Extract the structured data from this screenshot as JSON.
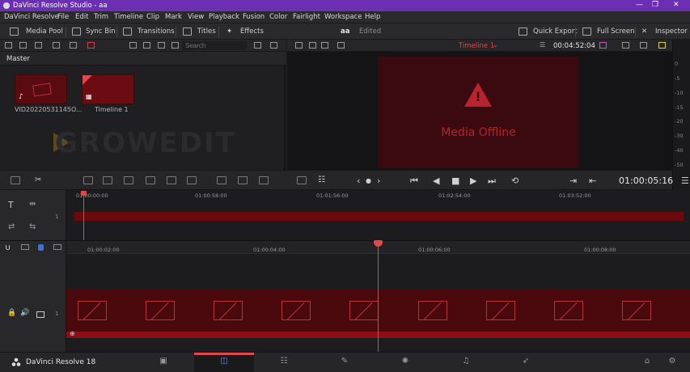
{
  "window": {
    "title": "DaVinci Resolve Studio - aa"
  },
  "menu": [
    "DaVinci Resolve",
    "File",
    "Edit",
    "Trim",
    "Timeline",
    "Clip",
    "Mark",
    "View",
    "Playback",
    "Fusion",
    "Color",
    "Fairlight",
    "Workspace",
    "Help"
  ],
  "toolbar": {
    "media_pool": "Media Pool",
    "sync_bin": "Sync Bin",
    "transitions": "Transitions",
    "titles": "Titles",
    "effects": "Effects",
    "project_name": "aa",
    "project_status": "Edited",
    "quick_export": "Quick Export",
    "full_screen": "Full Screen",
    "inspector": "Inspector"
  },
  "search": {
    "placeholder": "Search"
  },
  "viewer": {
    "timeline_name": "Timeline 1",
    "timecode": "00:04:52:04",
    "offline_text": "Media Offline"
  },
  "pool": {
    "bin": "Master",
    "clips": [
      {
        "label": "VID20220531145O..."
      },
      {
        "label": "Timeline 1"
      }
    ],
    "watermark": "GROWEDIT"
  },
  "meter_labels": [
    "0",
    "-5",
    "-10",
    "-15",
    "-20",
    "-30",
    "-40",
    "-50"
  ],
  "transport": {
    "timecode": "01:00:05:16"
  },
  "upper_ruler": [
    "01:00:00:00",
    "01:00:58:00",
    "01:01:56:00",
    "01:02:54:00",
    "01:03:52:00"
  ],
  "main_ruler": [
    "01:00:02:00",
    "01:00:04:00",
    "01:00:06:00",
    "01:00:08:00"
  ],
  "tracks": {
    "upper_index": "1",
    "video_index": "1"
  },
  "bottom": {
    "brand": "DaVinci Resolve 18"
  },
  "colors": {
    "accent": "#e0484a",
    "titlebar": "#6b2fb3",
    "clip": "#6a0a0f"
  }
}
